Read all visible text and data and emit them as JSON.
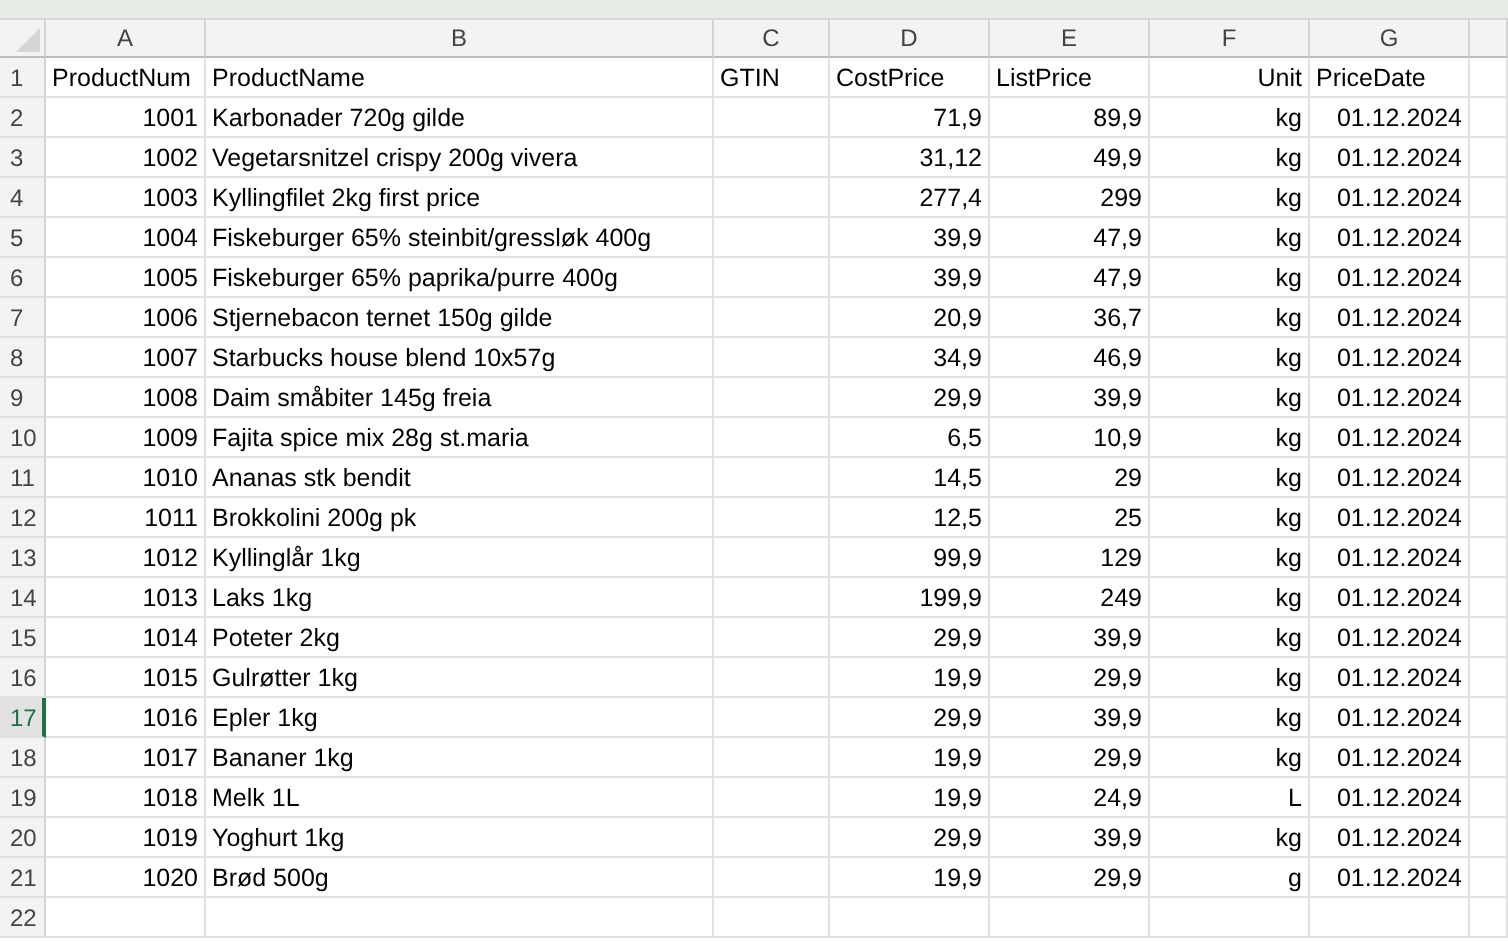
{
  "columns": [
    "A",
    "B",
    "C",
    "D",
    "E",
    "F",
    "G"
  ],
  "rows": [
    {
      "number": "1",
      "selected": false,
      "kind": "header",
      "cells": [
        "ProductNum",
        "ProductName",
        "GTIN",
        "CostPrice",
        "ListPrice",
        "Unit",
        "PriceDate"
      ]
    },
    {
      "number": "2",
      "selected": false,
      "kind": "data",
      "cells": [
        "1001",
        "Karbonader 720g gilde",
        null,
        "71,9",
        "89,9",
        "kg",
        "01.12.2024"
      ]
    },
    {
      "number": "3",
      "selected": false,
      "kind": "data",
      "cells": [
        "1002",
        "Vegetarsnitzel crispy 200g vivera",
        null,
        "31,12",
        "49,9",
        "kg",
        "01.12.2024"
      ]
    },
    {
      "number": "4",
      "selected": false,
      "kind": "data",
      "cells": [
        "1003",
        "Kyllingfilet 2kg first price",
        null,
        "277,4",
        "299",
        "kg",
        "01.12.2024"
      ]
    },
    {
      "number": "5",
      "selected": false,
      "kind": "data",
      "cells": [
        "1004",
        "Fiskeburger 65% steinbit/gressløk 400g",
        null,
        "39,9",
        "47,9",
        "kg",
        "01.12.2024"
      ]
    },
    {
      "number": "6",
      "selected": false,
      "kind": "data",
      "cells": [
        "1005",
        "Fiskeburger 65% paprika/purre 400g",
        null,
        "39,9",
        "47,9",
        "kg",
        "01.12.2024"
      ]
    },
    {
      "number": "7",
      "selected": false,
      "kind": "data",
      "cells": [
        "1006",
        "Stjernebacon ternet 150g gilde",
        null,
        "20,9",
        "36,7",
        "kg",
        "01.12.2024"
      ]
    },
    {
      "number": "8",
      "selected": false,
      "kind": "data",
      "cells": [
        "1007",
        "Starbucks house blend 10x57g",
        null,
        "34,9",
        "46,9",
        "kg",
        "01.12.2024"
      ]
    },
    {
      "number": "9",
      "selected": false,
      "kind": "data",
      "cells": [
        "1008",
        "Daim småbiter 145g freia",
        null,
        "29,9",
        "39,9",
        "kg",
        "01.12.2024"
      ]
    },
    {
      "number": "10",
      "selected": false,
      "kind": "data",
      "cells": [
        "1009",
        "Fajita spice mix 28g st.maria",
        null,
        "6,5",
        "10,9",
        "kg",
        "01.12.2024"
      ]
    },
    {
      "number": "11",
      "selected": false,
      "kind": "data",
      "cells": [
        "1010",
        "Ananas stk bendit",
        null,
        "14,5",
        "29",
        "kg",
        "01.12.2024"
      ]
    },
    {
      "number": "12",
      "selected": false,
      "kind": "data",
      "cells": [
        "1011",
        "Brokkolini 200g pk",
        null,
        "12,5",
        "25",
        "kg",
        "01.12.2024"
      ]
    },
    {
      "number": "13",
      "selected": false,
      "kind": "data",
      "cells": [
        "1012",
        "Kyllinglår 1kg",
        null,
        "99,9",
        "129",
        "kg",
        "01.12.2024"
      ]
    },
    {
      "number": "14",
      "selected": false,
      "kind": "data",
      "cells": [
        "1013",
        "Laks 1kg",
        null,
        "199,9",
        "249",
        "kg",
        "01.12.2024"
      ]
    },
    {
      "number": "15",
      "selected": false,
      "kind": "data",
      "cells": [
        "1014",
        "Poteter 2kg",
        null,
        "29,9",
        "39,9",
        "kg",
        "01.12.2024"
      ]
    },
    {
      "number": "16",
      "selected": false,
      "kind": "data",
      "cells": [
        "1015",
        "Gulrøtter 1kg",
        null,
        "19,9",
        "29,9",
        "kg",
        "01.12.2024"
      ]
    },
    {
      "number": "17",
      "selected": true,
      "kind": "data",
      "cells": [
        "1016",
        "Epler 1kg",
        null,
        "29,9",
        "39,9",
        "kg",
        "01.12.2024"
      ]
    },
    {
      "number": "18",
      "selected": false,
      "kind": "data",
      "cells": [
        "1017",
        "Bananer 1kg",
        null,
        "19,9",
        "29,9",
        "kg",
        "01.12.2024"
      ]
    },
    {
      "number": "19",
      "selected": false,
      "kind": "data",
      "cells": [
        "1018",
        "Melk 1L",
        null,
        "19,9",
        "24,9",
        "L",
        "01.12.2024"
      ]
    },
    {
      "number": "20",
      "selected": false,
      "kind": "data",
      "cells": [
        "1019",
        "Yoghurt 1kg",
        null,
        "29,9",
        "39,9",
        "kg",
        "01.12.2024"
      ]
    },
    {
      "number": "21",
      "selected": false,
      "kind": "data",
      "cells": [
        "1020",
        "Brød 500g",
        null,
        "19,9",
        "29,9",
        "g",
        "01.12.2024"
      ]
    },
    {
      "number": "22",
      "selected": false
    }
  ]
}
